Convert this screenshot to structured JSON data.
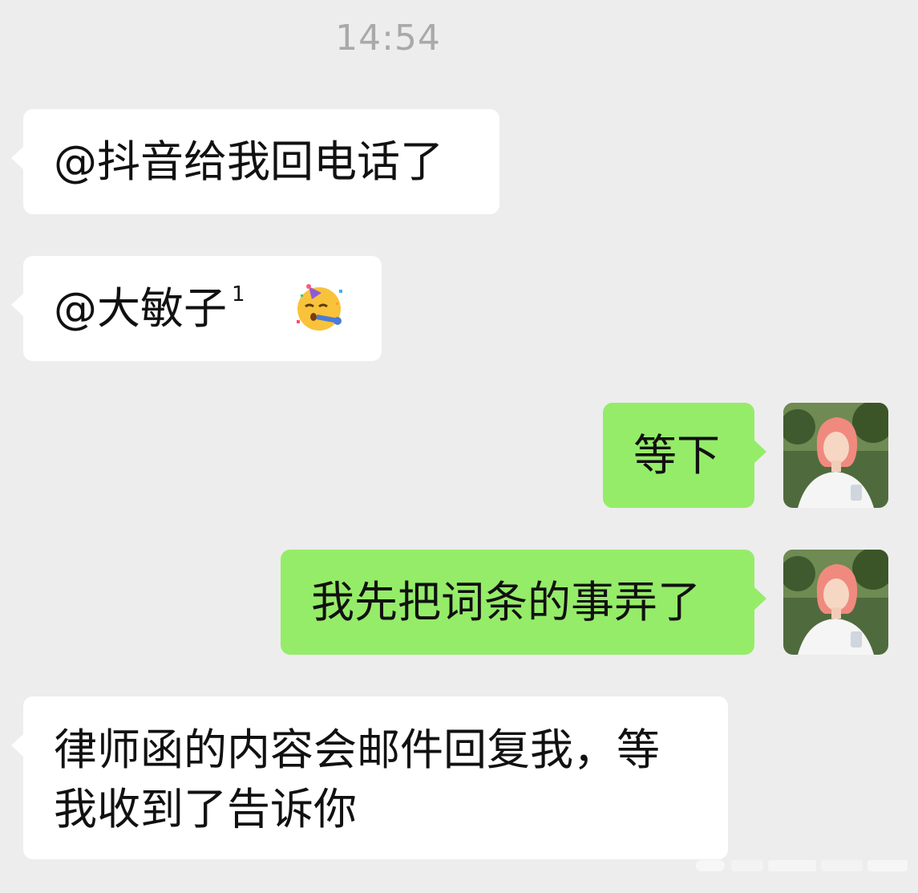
{
  "timestamp": "14:54",
  "messages": [
    {
      "direction": "incoming",
      "text": "@抖音给我回电话了"
    },
    {
      "direction": "incoming",
      "text": "@大敏子",
      "superscript": "1",
      "emoji": "partying-face-emoji"
    },
    {
      "direction": "outgoing",
      "text": "等下",
      "avatar": "user-avatar"
    },
    {
      "direction": "outgoing",
      "text": "我先把词条的事弄了",
      "avatar": "user-avatar"
    },
    {
      "direction": "incoming",
      "line1": "律师函的内容会邮件回复我，等",
      "line2": "我收到了告诉你"
    }
  ],
  "colors": {
    "background": "#ededed",
    "incoming_bubble": "#ffffff",
    "outgoing_bubble": "#95ec69",
    "timestamp_text": "#a9a9a9",
    "avatar_hair": "#f08a7e"
  }
}
